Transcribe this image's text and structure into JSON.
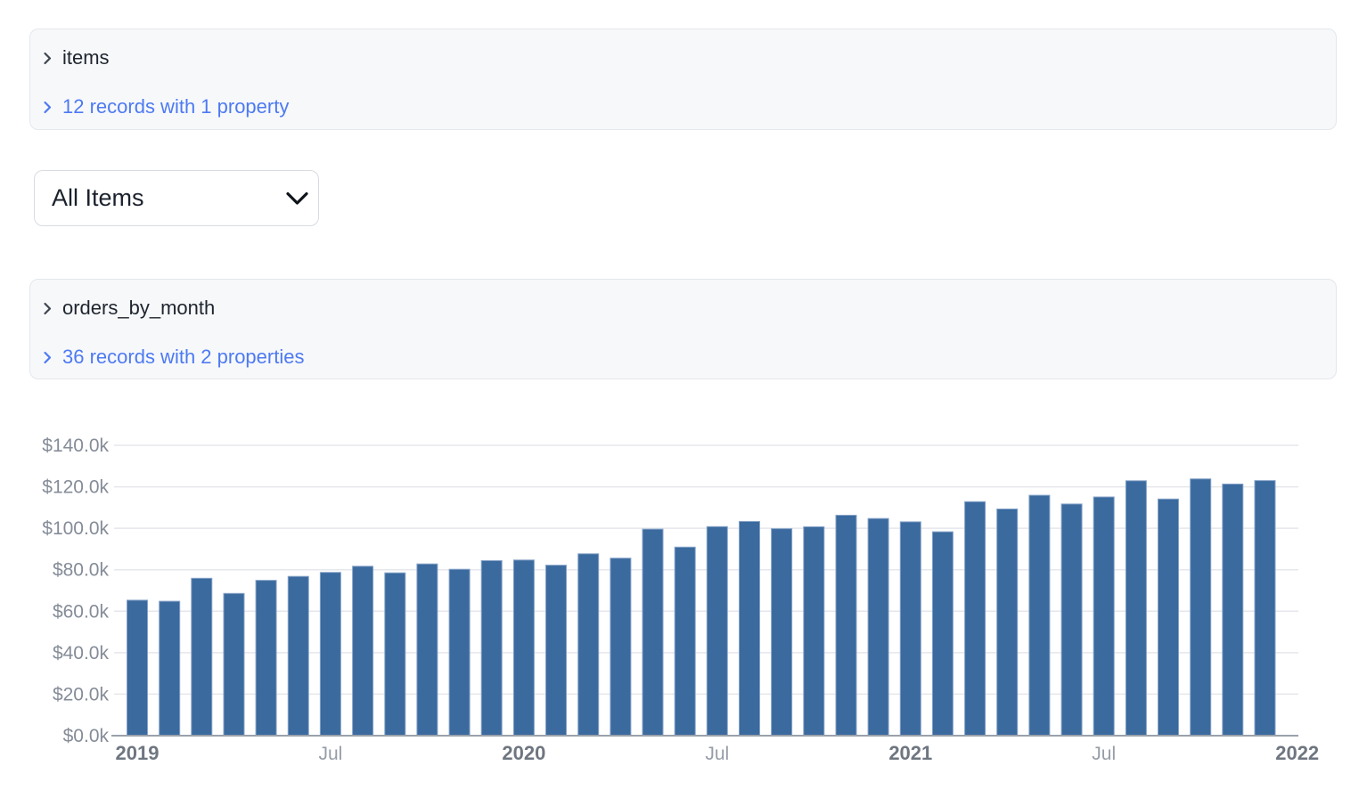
{
  "panels": {
    "items": {
      "title": "items",
      "records_label": "12 records with 1 property"
    },
    "orders": {
      "title": "orders_by_month",
      "records_label": "36 records with 2 properties"
    }
  },
  "filter": {
    "selected": "All Items"
  },
  "chart_data": {
    "type": "bar",
    "x": [
      "2019-01",
      "2019-02",
      "2019-03",
      "2019-04",
      "2019-05",
      "2019-06",
      "2019-07",
      "2019-08",
      "2019-09",
      "2019-10",
      "2019-11",
      "2019-12",
      "2020-01",
      "2020-02",
      "2020-03",
      "2020-04",
      "2020-05",
      "2020-06",
      "2020-07",
      "2020-08",
      "2020-09",
      "2020-10",
      "2020-11",
      "2020-12",
      "2021-01",
      "2021-02",
      "2021-03",
      "2021-04",
      "2021-05",
      "2021-06",
      "2021-07",
      "2021-08",
      "2021-09",
      "2021-10",
      "2021-11",
      "2021-12"
    ],
    "values": [
      65.3,
      64.8,
      75.9,
      68.6,
      74.9,
      76.8,
      78.7,
      81.7,
      78.5,
      82.8,
      80.2,
      84.4,
      84.7,
      82.2,
      87.7,
      85.6,
      99.6,
      90.9,
      100.8,
      103.3,
      99.8,
      100.7,
      106.3,
      104.7,
      103.1,
      98.3,
      112.8,
      109.3,
      115.9,
      111.7,
      115.1,
      122.9,
      114.1,
      123.8,
      121.3,
      123.0
    ],
    "unit": "k USD",
    "ylim": [
      0,
      140
    ],
    "grid": true,
    "legend": "none",
    "y_ticks": [
      {
        "value": 0,
        "label": "$0.0k"
      },
      {
        "value": 20,
        "label": "$20.0k"
      },
      {
        "value": 40,
        "label": "$40.0k"
      },
      {
        "value": 60,
        "label": "$60.0k"
      },
      {
        "value": 80,
        "label": "$80.0k"
      },
      {
        "value": 100,
        "label": "$100.0k"
      },
      {
        "value": 120,
        "label": "$120.0k"
      },
      {
        "value": 140,
        "label": "$140.0k"
      }
    ],
    "x_ticks": [
      {
        "month_index": 0,
        "label": "2019",
        "bold": true
      },
      {
        "month_index": 6,
        "label": "Jul",
        "bold": false
      },
      {
        "month_index": 12,
        "label": "2020",
        "bold": true
      },
      {
        "month_index": 18,
        "label": "Jul",
        "bold": false
      },
      {
        "month_index": 24,
        "label": "2021",
        "bold": true
      },
      {
        "month_index": 30,
        "label": "Jul",
        "bold": false
      },
      {
        "month_index": 36,
        "label": "2022",
        "bold": true
      }
    ],
    "colors": {
      "bar": "#3a6a9e",
      "bar_edge": "#87a3c8",
      "grid": "#e6e7ec",
      "axis": "#9aa1ab",
      "y_tick_label": "#858c98",
      "x_year_label": "#6e7680",
      "x_month_label": "#969da7"
    }
  }
}
